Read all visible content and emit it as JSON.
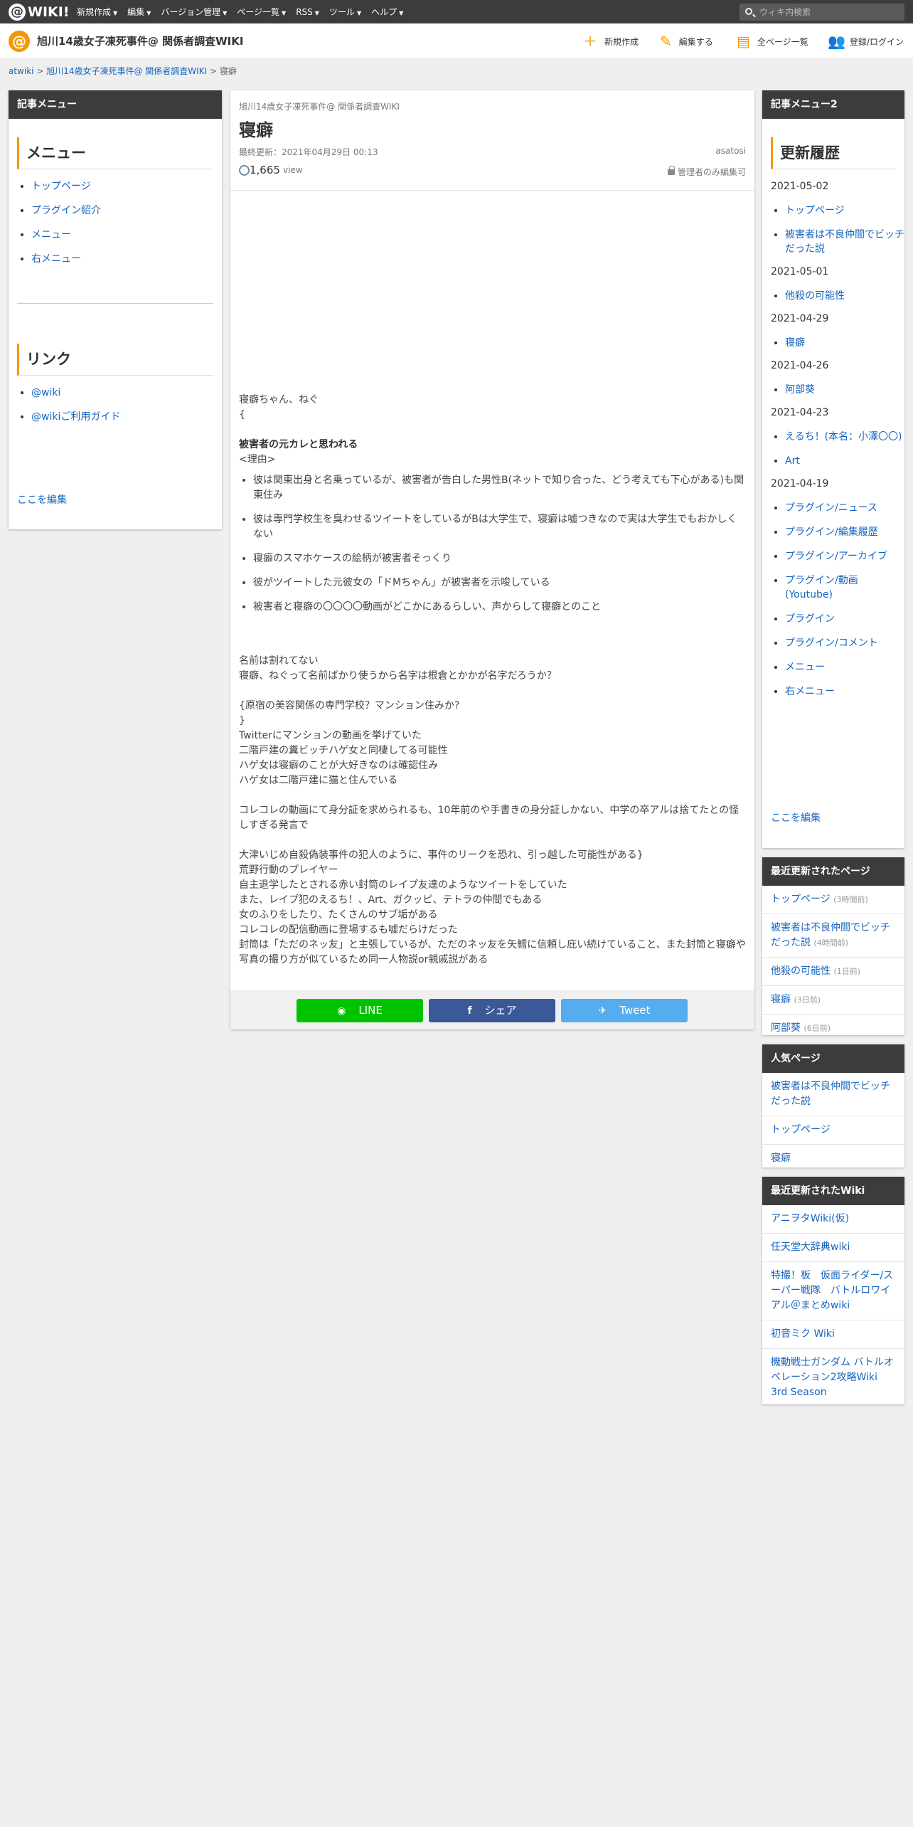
{
  "topbar": {
    "logo_text": "WIKI!",
    "menu": [
      "新規作成",
      "編集",
      "バージョン管理",
      "ページ一覧",
      "RSS",
      "ツール",
      "ヘルプ"
    ],
    "search_placeholder": "ウィキ内検索"
  },
  "header": {
    "site_title": "旭川14歳女子凍死事件@ 関係者調査WIKI",
    "buttons": [
      "新規作成",
      "編集する",
      "全ページ一覧",
      "登録/ログイン"
    ]
  },
  "breadcrumb": {
    "root": "atwiki",
    "sep": ">",
    "wiki": "旭川14歳女子凍死事件@ 関係者調査WIKI",
    "current": "寝癖"
  },
  "left": {
    "head": "記事メニュー",
    "menu_title": "メニュー",
    "menu_items": [
      "トップページ",
      "プラグイン紹介",
      "メニュー",
      "右メニュー"
    ],
    "link_title": "リンク",
    "link_items": [
      "@wiki",
      "@wikiご利用ガイド"
    ],
    "edit": "ここを編集"
  },
  "article": {
    "wiki_name": "旭川14歳女子凍死事件@ 関係者調査WIKI",
    "title": "寝癖",
    "updated": "最終更新：2021年04月29日 00:13",
    "author": "asatosi",
    "views": "1,665",
    "views_unit": "view",
    "lock_note": "管理者のみ編集可",
    "lines_a": [
      "寝癖ちゃん、ねぐ",
      "{",
      ""
    ],
    "bold_line": "被害者の元カレと思われる",
    "reason": "<理由>",
    "bullets": [
      "彼は関東出身と名乗っているが、被害者が告白した男性B(ネットで知り合った、どう考えても下心がある)も関東住み",
      "彼は専門学校生を臭わせるツイートをしているがBは大学生で、寝癖は嘘つきなので実は大学生でもおかしくない",
      "寝癖のスマホケースの絵柄が被害者そっくり",
      "彼がツイートした元彼女の「ドMちゃん」が被害者を示唆している",
      "被害者と寝癖の〇〇〇〇動画がどこかにあるらしい、声からして寝癖とのこと"
    ],
    "lines_b": [
      "",
      "",
      "名前は割れてない",
      "寝癖、ねぐって名前ばかり使うから名字は根倉とかかが名字だろうか？",
      "",
      "{原宿の美容関係の専門学校？マンション住みか?",
      "}",
      "Twitterにマンションの動画を挙げていた",
      "二階戸建の糞ビッチハゲ女と同棲してる可能性",
      "ハゲ女は寝癖のことが大好きなのは確認住み",
      "ハゲ女は二階戸建に猫と住んでいる",
      "",
      "コレコレの動画にて身分証を求められるも、10年前のや手書きの身分証しかない、中学の卒アルは捨てたとの怪しすぎる発言で",
      "",
      "大津いじめ自殺偽装事件の犯人のように、事件のリークを恐れ、引っ越した可能性がある}",
      "荒野行動のプレイヤー",
      "自主退学したとされる赤い封筒のレイプ友達のようなツイートをしていた",
      "また、レイプ犯のえるち！、Art、ガクッピ、テトラの仲間でもある",
      "女のふりをしたり、たくさんのサブ垢がある",
      "コレコレの配信動画に登場するも嘘だらけだった",
      "封筒は「ただのネッ友」と主張しているが、ただのネッ友を矢鱈に信頼し庇い続けていること、また封筒と寝癖や写真の撮り方が似ているため同一人物説or親戚説がある"
    ],
    "share": {
      "line": "LINE",
      "facebook": "シェア",
      "twitter": "Tweet"
    }
  },
  "right": {
    "head": "記事メニュー2",
    "history_title": "更新履歴",
    "history": [
      {
        "date": "2021-05-02",
        "items": [
          "トップページ",
          "被害者は不良仲間でビッチだった説"
        ]
      },
      {
        "date": "2021-05-01",
        "items": [
          "他殺の可能性"
        ]
      },
      {
        "date": "2021-04-29",
        "items": [
          "寝癖"
        ]
      },
      {
        "date": "2021-04-26",
        "items": [
          "阿部葵"
        ]
      },
      {
        "date": "2021-04-23",
        "items": [
          "えるち！(本名：小澤〇〇)",
          "Art"
        ]
      },
      {
        "date": "2021-04-19",
        "items": [
          "プラグイン/ニュース",
          "プラグイン/編集履歴",
          "プラグイン/アーカイブ",
          "プラグイン/動画(Youtube)",
          "プラグイン",
          "プラグイン/コメント",
          "メニュー",
          "右メニュー"
        ]
      }
    ],
    "edit": "ここを編集",
    "recent_head": "最近更新されたページ",
    "recent": [
      {
        "name": "トップページ",
        "ago": "(3時間前)"
      },
      {
        "name": "被害者は不良仲間でビッチだった説",
        "ago": "(4時間前)"
      },
      {
        "name": "他殺の可能性",
        "ago": "(1日前)"
      },
      {
        "name": "寝癖",
        "ago": "(3日前)"
      },
      {
        "name": "阿部葵",
        "ago": "(6日前)"
      }
    ],
    "popular_head": "人気ページ",
    "popular": [
      "被害者は不良仲間でビッチだった説",
      "トップページ",
      "寝癖"
    ],
    "wikis_head": "最近更新されたWiki",
    "wikis": [
      "アニヲタWiki(仮)",
      "任天堂大辞典wiki",
      "特撮！板　仮面ライダー/スーパー戦隊　バトルロワイアル＠まとめwiki",
      "初音ミク Wiki",
      "機動戦士ガンダム バトルオペレーション2攻略Wiki 3rd Season"
    ]
  },
  "colors": {
    "accent": "#f39800",
    "dark": "#3c3c3c",
    "link": "#1565c0",
    "line": "#00c300",
    "facebook": "#3b5998",
    "twitter": "#55acee"
  }
}
